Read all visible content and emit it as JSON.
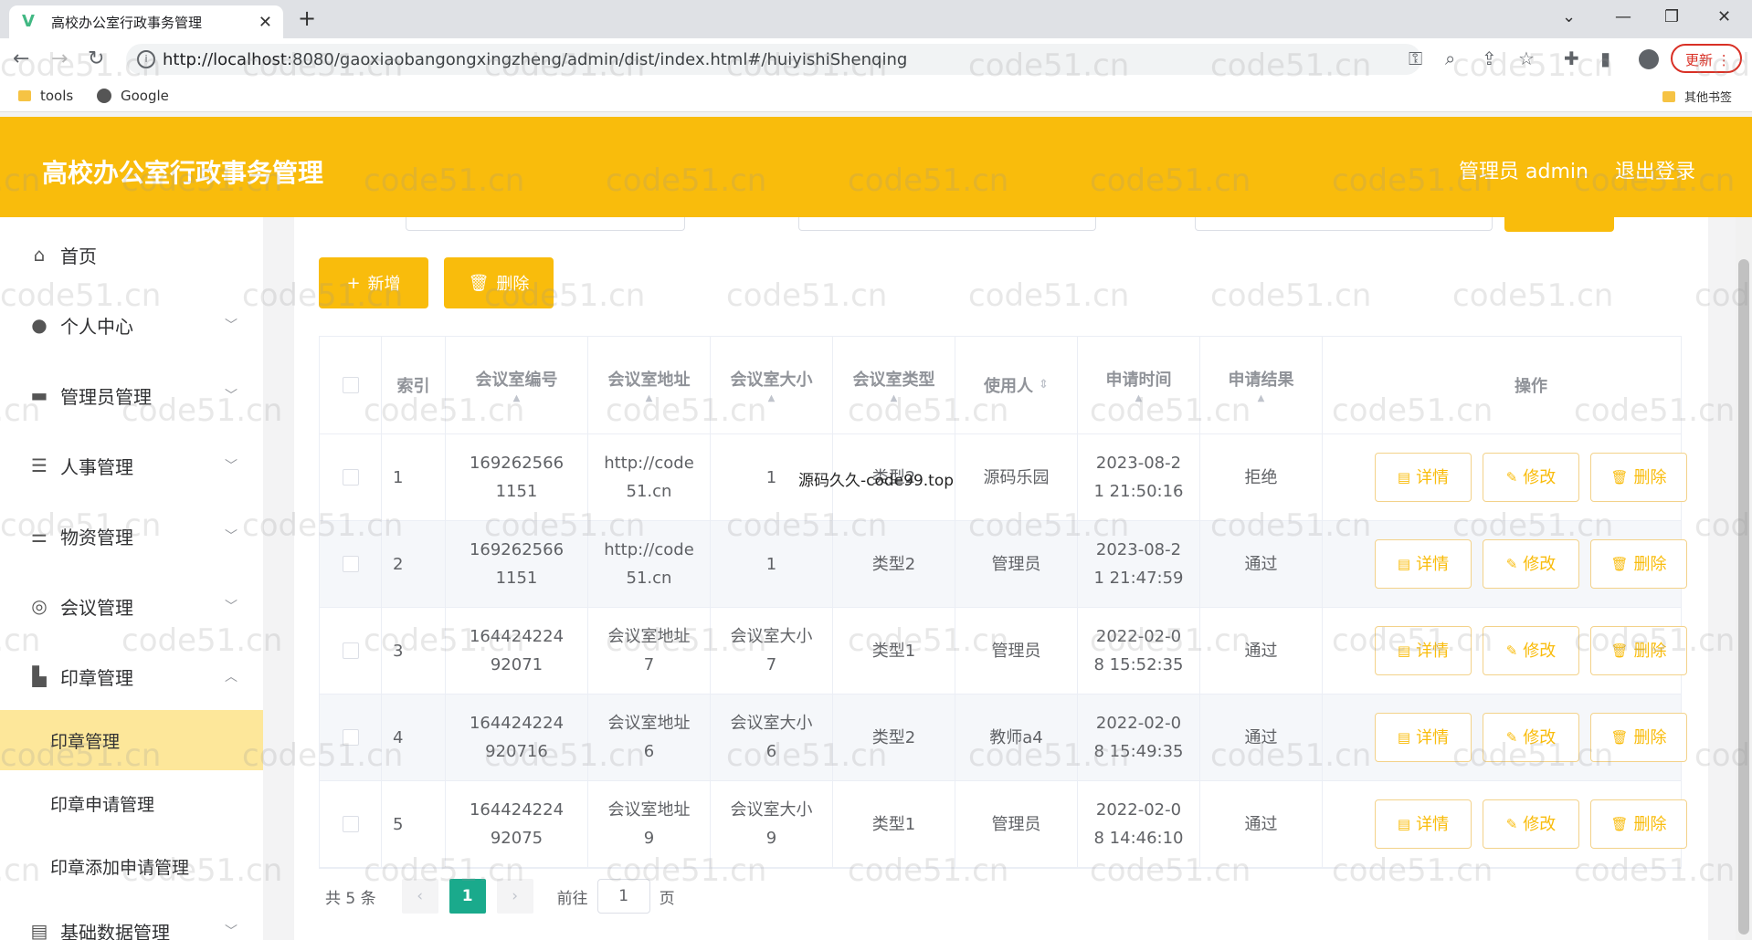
{
  "browser": {
    "tab_title": "高校办公室行政事务管理",
    "url_host": "http://localhost",
    "url_rest": ":8080/gaoxiaobangongxingzheng/admin/dist/index.html#/huiyishiShenqing",
    "update_label": "更新",
    "bookmarks": [
      "tools",
      "Google"
    ],
    "other_bookmarks": "其他书签"
  },
  "header": {
    "title": "高校办公室行政事务管理",
    "user_label": "管理员 admin",
    "logout_label": "退出登录"
  },
  "sidebar": {
    "items": [
      {
        "label": "首页",
        "icon": "home-icon"
      },
      {
        "label": "个人中心",
        "icon": "user-icon"
      },
      {
        "label": "管理员管理",
        "icon": "briefcase-icon"
      },
      {
        "label": "人事管理",
        "icon": "list-icon"
      },
      {
        "label": "物资管理",
        "icon": "sliders-icon"
      },
      {
        "label": "会议管理",
        "icon": "compass-icon"
      },
      {
        "label": "印章管理",
        "icon": "bar-chart-icon"
      }
    ],
    "subitems": [
      "印章管理",
      "印章申请管理",
      "印章添加申请管理"
    ],
    "bottom_item": "基础数据管理"
  },
  "toolbar": {
    "add_label": "新增",
    "delete_label": "删除"
  },
  "table": {
    "columns": [
      "索引",
      "会议室编号",
      "会议室地址",
      "会议室大小",
      "会议室类型",
      "使用人",
      "申请时间",
      "申请结果",
      "操作"
    ],
    "rows": [
      {
        "idx": "1",
        "code": [
          "169262566",
          "1151"
        ],
        "addr": [
          "http://code",
          "51.cn"
        ],
        "size": [
          "1"
        ],
        "type": "类型2",
        "user": "源码乐园",
        "time": [
          "2023-08-2",
          "1 21:50:16"
        ],
        "result": "拒绝"
      },
      {
        "idx": "2",
        "code": [
          "169262566",
          "1151"
        ],
        "addr": [
          "http://code",
          "51.cn"
        ],
        "size": [
          "1"
        ],
        "type": "类型2",
        "user": "管理员",
        "time": [
          "2023-08-2",
          "1 21:47:59"
        ],
        "result": "通过"
      },
      {
        "idx": "3",
        "code": [
          "164424224",
          "92071"
        ],
        "addr": [
          "会议室地址",
          "7"
        ],
        "size": [
          "会议室大小",
          "7"
        ],
        "type": "类型1",
        "user": "管理员",
        "time": [
          "2022-02-0",
          "8 15:52:35"
        ],
        "result": "通过"
      },
      {
        "idx": "4",
        "code": [
          "164424224",
          "920716"
        ],
        "addr": [
          "会议室地址",
          "6"
        ],
        "size": [
          "会议室大小",
          "6"
        ],
        "type": "类型2",
        "user": "教师a4",
        "time": [
          "2022-02-0",
          "8 15:49:35"
        ],
        "result": "通过"
      },
      {
        "idx": "5",
        "code": [
          "164424224",
          "92075"
        ],
        "addr": [
          "会议室地址",
          "9"
        ],
        "size": [
          "会议室大小",
          "9"
        ],
        "type": "类型1",
        "user": "管理员",
        "time": [
          "2022-02-0",
          "8 14:46:10"
        ],
        "result": "通过"
      }
    ],
    "op_labels": {
      "detail": "详情",
      "edit": "修改",
      "delete": "删除"
    }
  },
  "pagination": {
    "total_label": "共 5 条",
    "current": "1",
    "goto_label": "前往",
    "goto_value": "1",
    "page_suffix": "页"
  },
  "overlay_text": "源码久久-code99.top",
  "watermark_text": "code51.cn",
  "colors": {
    "accent": "#f9bc0c",
    "page_active": "#1aaa8c",
    "submenu_active": "#fde79a"
  }
}
